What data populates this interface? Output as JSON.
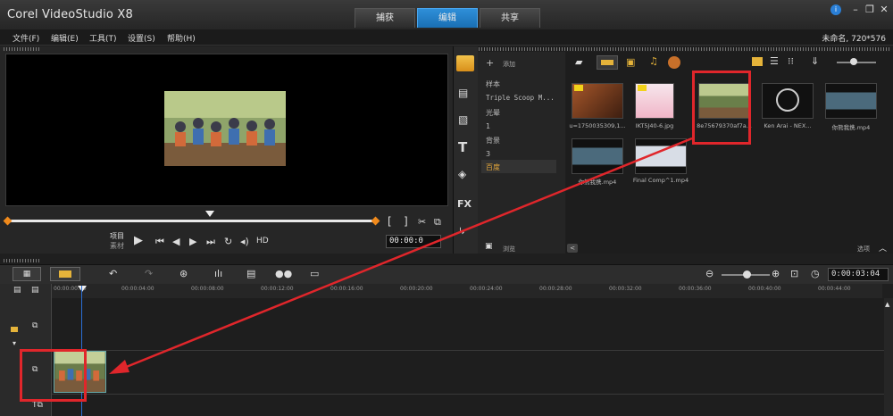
{
  "app_title": "Corel VideoStudio X8",
  "tabs": [
    {
      "label": "捕获"
    },
    {
      "label": "编辑"
    },
    {
      "label": "共享"
    }
  ],
  "menu": [
    {
      "label": "文件(F)"
    },
    {
      "label": "编辑(E)"
    },
    {
      "label": "工具(T)"
    },
    {
      "label": "设置(S)"
    },
    {
      "label": "帮助(H)"
    }
  ],
  "project_info": "未命名, 720*576",
  "preview": {
    "mode_project": "项目",
    "mode_clip": "素材",
    "hd_label": "HD",
    "timecode": "00:00:0",
    "bracket_in": "[",
    "bracket_out": "]"
  },
  "library": {
    "add_label": "添加",
    "browse_label": "浏览",
    "nav_items": [
      {
        "label": "样本"
      },
      {
        "label": "Triple Scoop M..."
      },
      {
        "label": "光晕"
      },
      {
        "label": "1"
      },
      {
        "label": "背景"
      },
      {
        "label": "3"
      },
      {
        "label": "百度"
      }
    ],
    "thumbnails": [
      {
        "label": "u=1750035309,1..."
      },
      {
        "label": "IKT5J40-6.jpg"
      },
      {
        "label": "8e75679370af7a..."
      },
      {
        "label": "Ken Arai - NEX..."
      },
      {
        "label": "你熊我携.mp4"
      },
      {
        "label": "你熊我携.mp4"
      },
      {
        "label": "Final Comp^1.mp4"
      }
    ],
    "options_label": "选项"
  },
  "timeline": {
    "timecode": "0:00:03:04",
    "ruler_ticks": [
      "00:00:00:00",
      "00:00:04:00",
      "00:00:08:00",
      "00:00:12:00",
      "00:00:16:00",
      "00:00:20:00",
      "00:00:24:00",
      "00:00:28:00",
      "00:00:32:00",
      "00:00:36:00",
      "00:00:40:00",
      "00:00:44:00"
    ]
  },
  "colors": {
    "accent_blue": "#1a6fb3",
    "highlight_red": "#e0262b",
    "selection_orange": "#e8a93a",
    "playhead": "#2b6fd6"
  },
  "icons": {
    "info": "info-icon",
    "play": "play-icon",
    "library_add": "plus-icon"
  }
}
